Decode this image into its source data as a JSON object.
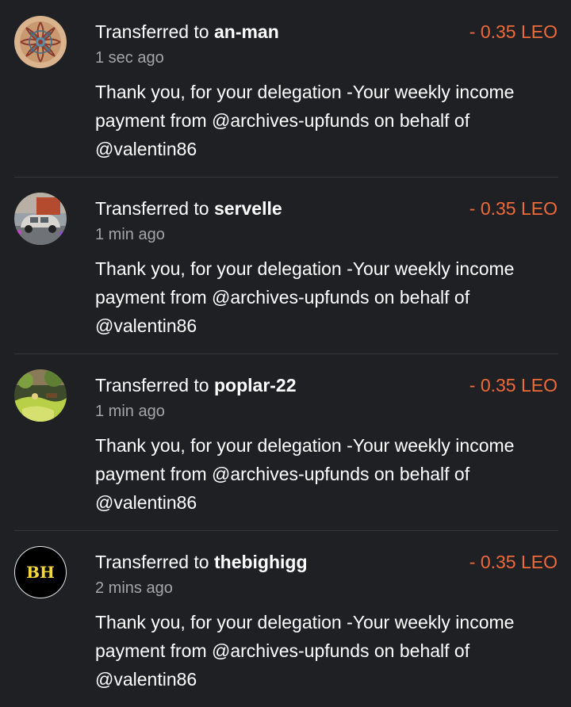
{
  "transactions": [
    {
      "action": "Transferred to ",
      "user": "an-man",
      "amount": "- 0.35 LEO",
      "time": "1 sec ago",
      "memo": "Thank you, for your delegation -Your weekly income payment from @archives-upfunds on behalf of @valentin86",
      "avatar_icon": "mandala-avatar-icon"
    },
    {
      "action": "Transferred to ",
      "user": "servelle",
      "amount": "- 0.35 LEO",
      "time": "1 min ago",
      "memo": "Thank you, for your delegation -Your weekly income payment from @archives-upfunds on behalf of @valentin86",
      "avatar_icon": "car-avatar-icon"
    },
    {
      "action": "Transferred to ",
      "user": "poplar-22",
      "amount": "- 0.35 LEO",
      "time": "1 min ago",
      "memo": "Thank you, for your delegation -Your weekly income payment from @archives-upfunds on behalf of @valentin86",
      "avatar_icon": "garden-avatar-icon"
    },
    {
      "action": "Transferred to ",
      "user": "thebighigg",
      "amount": "- 0.35 LEO",
      "time": "2 mins ago",
      "memo": "Thank you, for your delegation -Your weekly income payment from @archives-upfunds on behalf of @valentin86",
      "avatar_icon": "bh-logo-avatar-icon",
      "avatar_text": "BH"
    }
  ],
  "colors": {
    "background": "#1f2024",
    "amount": "#ee6a3a",
    "muted_text": "#a4a5aa",
    "divider": "#35363b",
    "bh_logo": "#f3d83b"
  }
}
